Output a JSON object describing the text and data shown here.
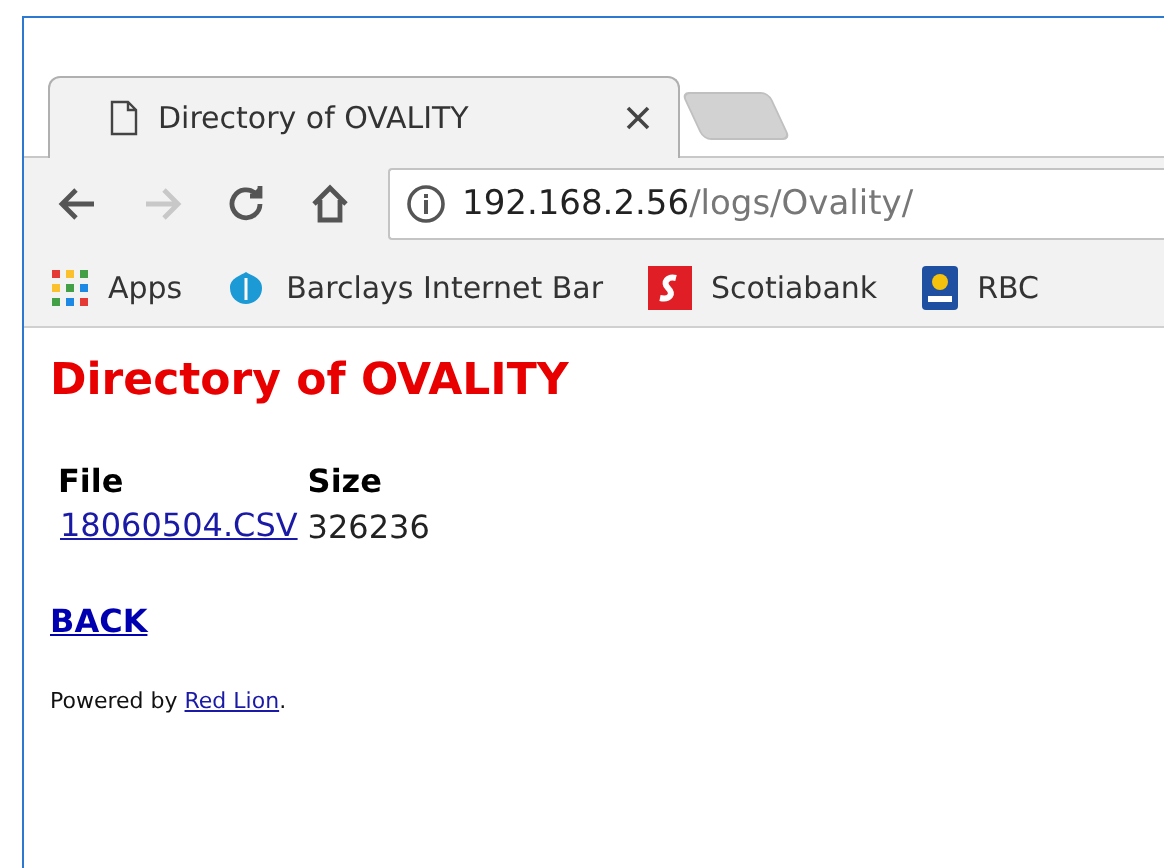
{
  "tabs": [
    {
      "title": "Directory of OVALITY",
      "selected": true
    }
  ],
  "nav_buttons": [
    {
      "kind": "back",
      "disabled": false
    },
    {
      "kind": "forward",
      "disabled": true
    },
    {
      "kind": "reload",
      "disabled": false
    },
    {
      "kind": "home",
      "disabled": false
    }
  ],
  "address": {
    "host": "192.168.2.56",
    "path": "/logs/Ovality/"
  },
  "bookmarks": [
    {
      "kind": "apps",
      "label": "Apps"
    },
    {
      "kind": "barclays",
      "label": "Barclays Internet Bar"
    },
    {
      "kind": "scotia",
      "label": "Scotiabank"
    },
    {
      "kind": "rbc",
      "label": "RBC"
    }
  ],
  "page": {
    "heading": "Directory of OVALITY",
    "columns": [
      "File",
      "Size"
    ],
    "rows": [
      [
        "18060504.CSV",
        "326236"
      ]
    ],
    "back_link": "BACK",
    "footer_text": "Powered by ",
    "footer_link": "Red Lion",
    "footer_end": "."
  }
}
